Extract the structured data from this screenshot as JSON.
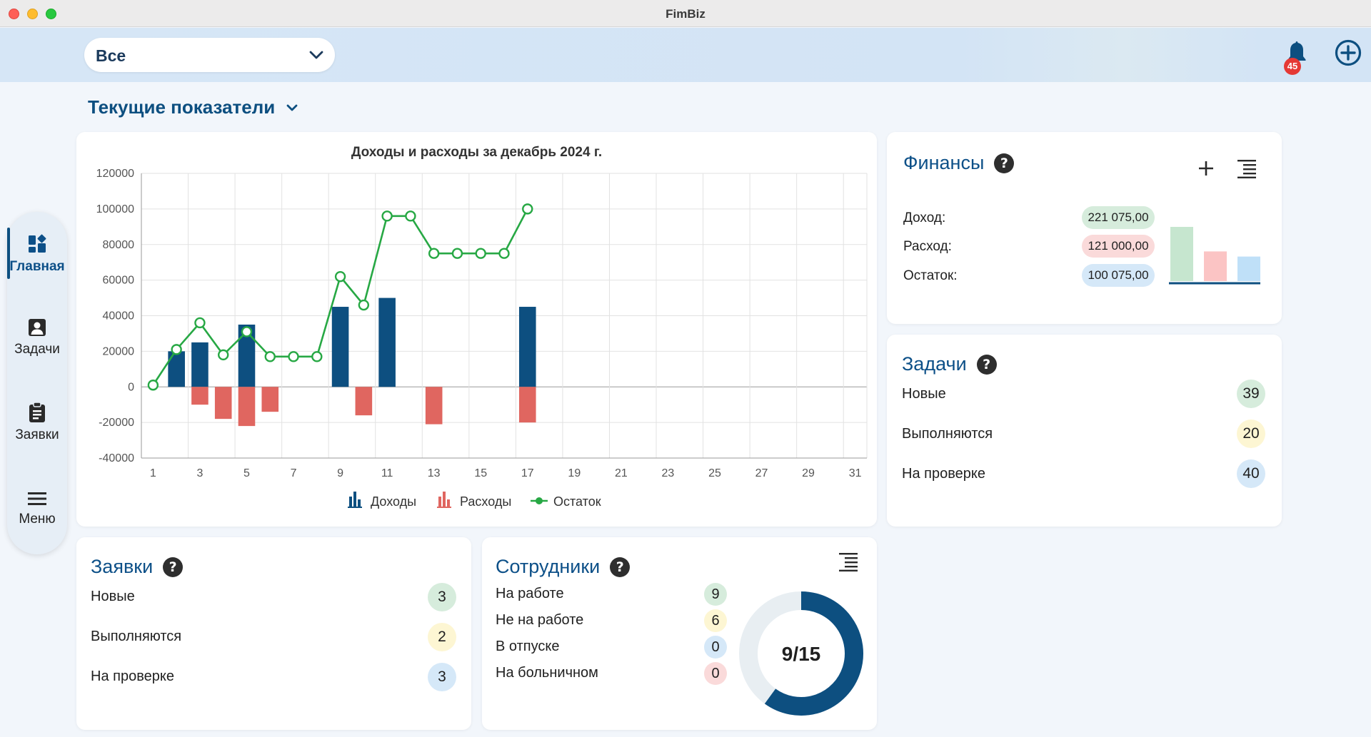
{
  "window": {
    "title": "FimBiz"
  },
  "header": {
    "filter_value": "Все",
    "notifications_count": "45"
  },
  "section": {
    "title": "Текущие показатели"
  },
  "sidebar": {
    "items": [
      {
        "label": "Главная",
        "icon": "dashboard-icon",
        "active": true
      },
      {
        "label": "Задачи",
        "icon": "contact-card-icon"
      },
      {
        "label": "Заявки",
        "icon": "clipboard-icon"
      },
      {
        "label": "Меню",
        "icon": "menu-icon"
      }
    ]
  },
  "income_chart": {
    "chart_data": {
      "type": "bar",
      "title": "Доходы и расходы за декабрь 2024 г.",
      "x": [
        1,
        2,
        3,
        4,
        5,
        6,
        7,
        8,
        9,
        10,
        11,
        12,
        13,
        14,
        15,
        16,
        17,
        18,
        19,
        20,
        21,
        22,
        23,
        24,
        25,
        26,
        27,
        28,
        29,
        30,
        31
      ],
      "x_tick_labels": [
        "1",
        "3",
        "5",
        "7",
        "9",
        "11",
        "13",
        "15",
        "17",
        "19",
        "21",
        "23",
        "25",
        "27",
        "29",
        "31"
      ],
      "ylim": [
        -40000,
        120000
      ],
      "y_tick_labels": [
        "120000",
        "100000",
        "80000",
        "60000",
        "40000",
        "20000",
        "0",
        "-20000",
        "-40000"
      ],
      "grid": true,
      "legend_position": "bottom",
      "series": [
        {
          "name": "Доходы",
          "type": "bar",
          "color": "#0d4f80",
          "points": [
            [
              2,
              20000
            ],
            [
              3,
              25000
            ],
            [
              5,
              35000
            ],
            [
              9,
              45000
            ],
            [
              11,
              50000
            ],
            [
              17,
              45000
            ]
          ]
        },
        {
          "name": "Расходы",
          "type": "bar",
          "color": "#e06660",
          "points": [
            [
              3,
              -10000
            ],
            [
              4,
              -18000
            ],
            [
              5,
              -22000
            ],
            [
              6,
              -14000
            ],
            [
              10,
              -16000
            ],
            [
              13,
              -21000
            ],
            [
              17,
              -20000
            ]
          ]
        },
        {
          "name": "Остаток",
          "type": "line",
          "color": "#27a844",
          "points": [
            [
              1,
              1000
            ],
            [
              2,
              21000
            ],
            [
              3,
              36000
            ],
            [
              4,
              18000
            ],
            [
              5,
              31000
            ],
            [
              6,
              17000
            ],
            [
              7,
              17000
            ],
            [
              8,
              17000
            ],
            [
              9,
              62000
            ],
            [
              10,
              46000
            ],
            [
              11,
              96000
            ],
            [
              12,
              96000
            ],
            [
              13,
              75000
            ],
            [
              14,
              75000
            ],
            [
              15,
              75000
            ],
            [
              16,
              75000
            ],
            [
              17,
              100000
            ]
          ]
        }
      ]
    }
  },
  "finance": {
    "title": "Финансы",
    "rows": [
      {
        "label": "Доход:",
        "value": "221 075,00"
      },
      {
        "label": "Расход:",
        "value": "121 000,00"
      },
      {
        "label": "Остаток:",
        "value": "100 075,00"
      }
    ],
    "mini_chart": {
      "type": "bar",
      "values": [
        221075,
        121000,
        100075
      ],
      "colors": [
        "#c6e6cf",
        "#fbc4c4",
        "#bfe0f8"
      ]
    }
  },
  "tasks": {
    "title": "Задачи",
    "rows": [
      {
        "label": "Новые",
        "value": "39"
      },
      {
        "label": "Выполняются",
        "value": "20"
      },
      {
        "label": "На проверке",
        "value": "40"
      }
    ]
  },
  "requests": {
    "title": "Заявки",
    "rows": [
      {
        "label": "Новые",
        "value": "3"
      },
      {
        "label": "Выполняются",
        "value": "2"
      },
      {
        "label": "На проверке",
        "value": "3"
      }
    ]
  },
  "employees": {
    "title": "Сотрудники",
    "rows": [
      {
        "label": "На работе",
        "value": "9"
      },
      {
        "label": "Не на работе",
        "value": "6"
      },
      {
        "label": "В отпуске",
        "value": "0"
      },
      {
        "label": "На больничном",
        "value": "0"
      }
    ],
    "donut_label": "9/15",
    "donut": {
      "value": 9,
      "total": 15
    }
  }
}
